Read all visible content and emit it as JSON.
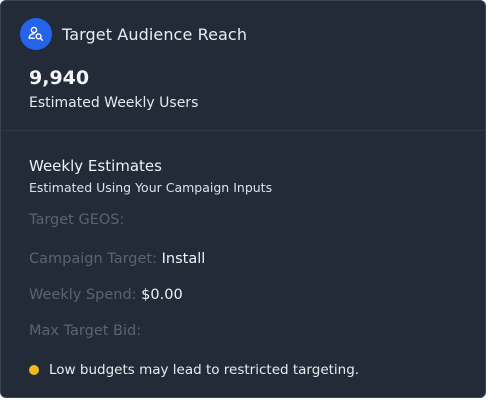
{
  "header": {
    "title": "Target Audience Reach",
    "icon": "audience-search-icon",
    "icon_color": "#2563eb"
  },
  "reach": {
    "value": "9,940",
    "label": "Estimated Weekly Users"
  },
  "estimates": {
    "title": "Weekly Estimates",
    "subtitle": "Estimated Using Your Campaign Inputs",
    "fields": [
      {
        "label": "Target GEOS:",
        "value": ""
      },
      {
        "label": "Campaign Target:",
        "value": "Install"
      },
      {
        "label": "Weekly Spend:",
        "value": "$0.00"
      },
      {
        "label": "Max Target Bid:",
        "value": ""
      }
    ]
  },
  "note": {
    "text": "Low budgets may lead to restricted targeting.",
    "dot_color": "#f2b81d"
  },
  "colors": {
    "panel_bg": "#232b38",
    "muted_label": "#596373",
    "value_text": "#f1f4f8"
  }
}
